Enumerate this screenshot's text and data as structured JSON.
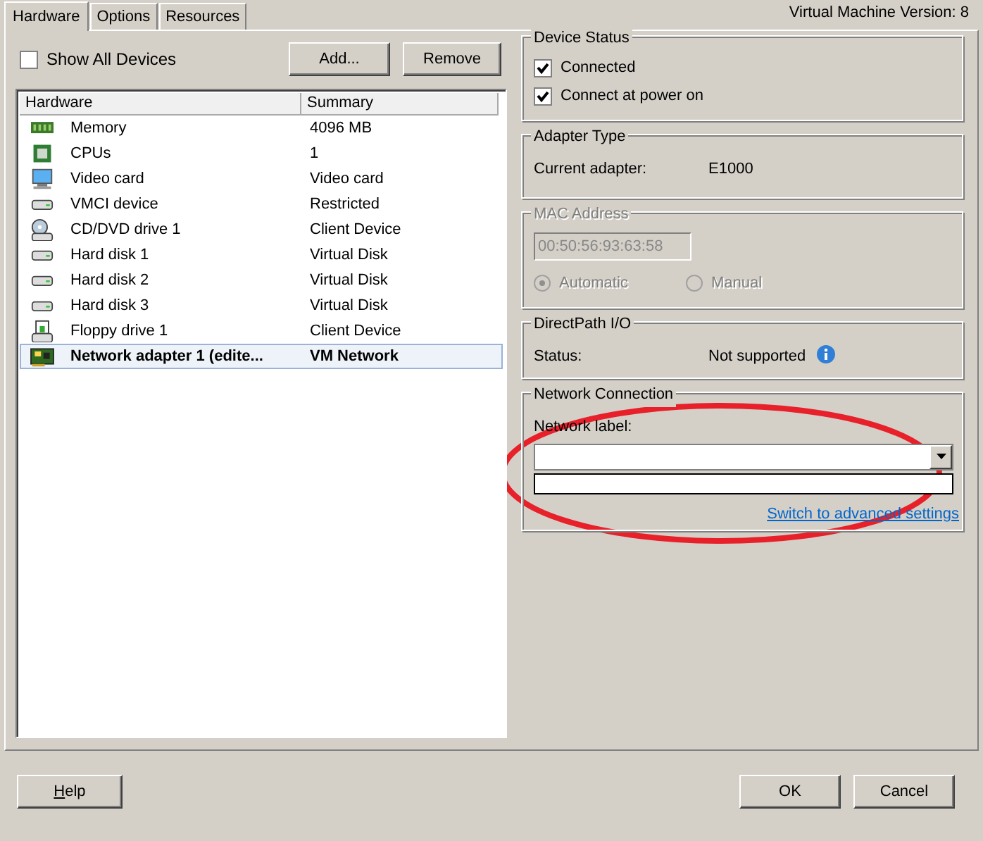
{
  "tabs": [
    {
      "label": "Hardware",
      "selected": true
    },
    {
      "label": "Options",
      "selected": false
    },
    {
      "label": "Resources",
      "selected": false
    }
  ],
  "version": "Virtual Machine Version: 8",
  "show_all_devices": {
    "label": "Show All Devices",
    "checked": false
  },
  "buttons": [
    "Add...",
    "Remove"
  ],
  "hardware_table": {
    "columns": [
      "Hardware",
      "Summary"
    ],
    "rows": [
      {
        "kind": "memory",
        "name": "Memory",
        "summary": "4096 MB",
        "selected": false
      },
      {
        "kind": "cpu",
        "name": "CPUs",
        "summary": "1",
        "selected": false
      },
      {
        "kind": "monitor",
        "name": "Video card",
        "summary": "Video card",
        "selected": false
      },
      {
        "kind": "disk",
        "name": "VMCI device",
        "summary": "Restricted",
        "selected": false
      },
      {
        "kind": "cdrom",
        "name": "CD/DVD drive 1",
        "summary": "Client Device",
        "selected": false
      },
      {
        "kind": "disk",
        "name": "Hard disk 1",
        "summary": "Virtual Disk",
        "selected": false
      },
      {
        "kind": "disk",
        "name": "Hard disk 2",
        "summary": "Virtual Disk",
        "selected": false
      },
      {
        "kind": "disk",
        "name": "Hard disk 3",
        "summary": "Virtual Disk",
        "selected": false
      },
      {
        "kind": "floppy",
        "name": "Floppy drive 1",
        "summary": "Client Device",
        "selected": false
      },
      {
        "kind": "nic",
        "name": "Network adapter 1 (edite...",
        "summary": "VM Network",
        "selected": true
      }
    ]
  },
  "device_status": {
    "title": "Device Status",
    "options": [
      {
        "label": "Connected",
        "checked": true
      },
      {
        "label": "Connect at power on",
        "checked": true
      }
    ]
  },
  "adapter_type": {
    "title": "Adapter Type",
    "label": "Current adapter:",
    "value": "E1000"
  },
  "mac_address": {
    "title": "MAC Address",
    "disabled": true,
    "value": "00:50:56:93:63:58",
    "options": [
      {
        "label": "Automatic",
        "selected": true
      },
      {
        "label": "Manual",
        "selected": false
      }
    ]
  },
  "directpath": {
    "title": "DirectPath I/O",
    "label": "Status:",
    "value": "Not supported"
  },
  "network_connection": {
    "title": "Network Connection",
    "label": "Network label:",
    "link": "Switch to advanced settings"
  },
  "footer_buttons": [
    {
      "label": "Help"
    },
    {
      "label": "OK"
    },
    {
      "label": "Cancel"
    }
  ]
}
